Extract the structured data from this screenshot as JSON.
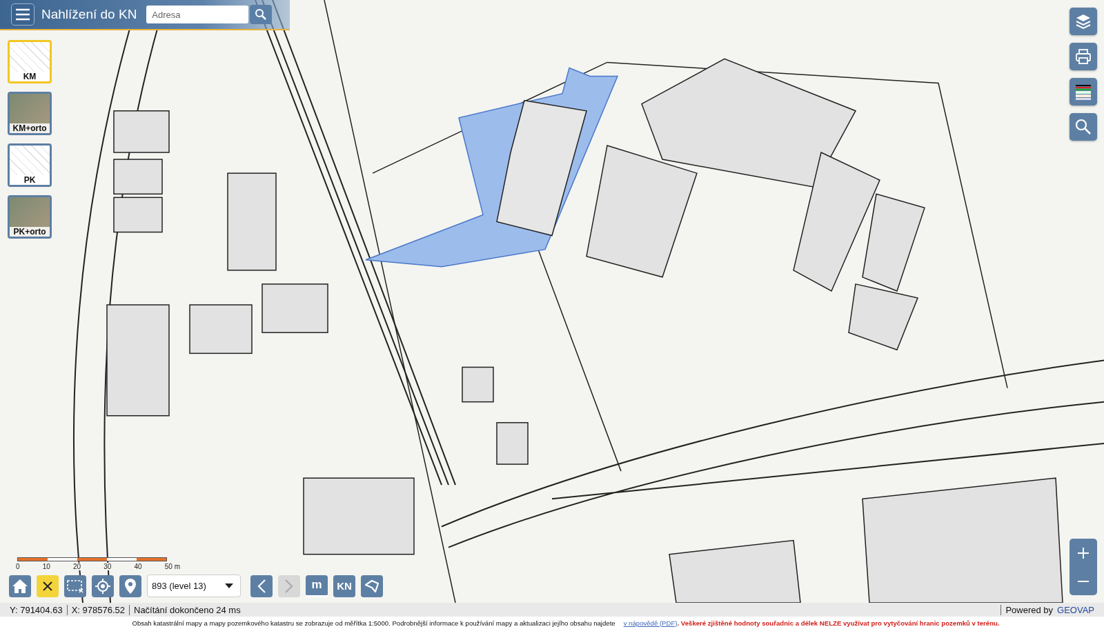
{
  "header": {
    "title": "Nahlížení do KN",
    "search": {
      "placeholder": "Adresa"
    }
  },
  "layers": [
    {
      "label": "KM",
      "selected": true
    },
    {
      "label": "KM+orto",
      "selected": false
    },
    {
      "label": "PK",
      "selected": false
    },
    {
      "label": "PK+orto",
      "selected": false
    }
  ],
  "scale_bar": {
    "labels": [
      "0",
      "10",
      "20",
      "30",
      "40",
      "50 m"
    ]
  },
  "toolbar": {
    "left_tools": [
      {
        "kind": "home",
        "active": false
      },
      {
        "kind": "clear",
        "active": true
      },
      {
        "kind": "select",
        "active": false
      },
      {
        "kind": "locate",
        "active": false
      },
      {
        "kind": "pin",
        "active": false
      }
    ],
    "zoom_select": {
      "value": "893 (level 13)"
    },
    "nav": [
      {
        "kind": "back",
        "disabled": false
      },
      {
        "kind": "forward",
        "disabled": true
      }
    ],
    "right_tools": [
      {
        "kind": "measure",
        "label": "m"
      },
      {
        "kind": "text",
        "label": "KN"
      },
      {
        "kind": "polygon"
      }
    ]
  },
  "status_bar": {
    "y": "Y: 791404.63",
    "x": "X: 978576.52",
    "message": "Načítání dokončeno 24 ms",
    "powered_by": "Powered by",
    "brand": "GEOVAP"
  },
  "notice": {
    "text": "Obsah katastrální mapy a mapy pozemkového katastru se zobrazuje od měřítka 1:5000. Podrobnější informace k používání mapy a aktualizaci jejího obsahu najdete",
    "link": "v nápovědě (PDF)",
    "warning": ". Veškeré zjištěné hodnoty souřadnic a délek NELZE využívat pro vytyčování hranic pozemků v terénu."
  }
}
